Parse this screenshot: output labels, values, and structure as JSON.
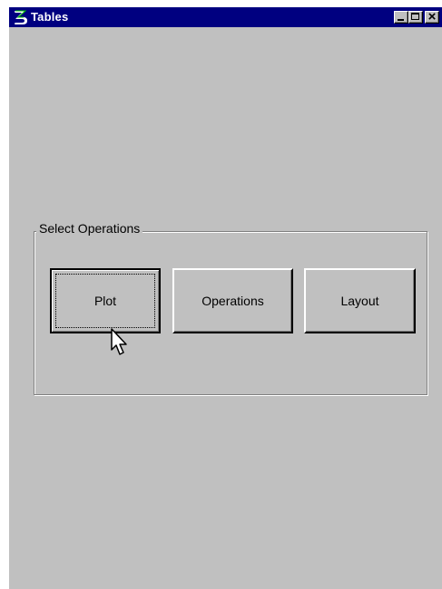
{
  "window": {
    "title": "Tables"
  },
  "titlebar_buttons": {
    "minimize_icon": "minimize-icon",
    "maximize_icon": "maximize-icon",
    "close_icon": "close-icon",
    "close_glyph": "×"
  },
  "group": {
    "label": "Select Operations"
  },
  "buttons": {
    "plot": "Plot",
    "operations": "Operations",
    "layout": "Layout"
  },
  "colors": {
    "titlebar": "#000080",
    "window_bg": "#c0c0c0",
    "icon_green": "#00c000"
  }
}
